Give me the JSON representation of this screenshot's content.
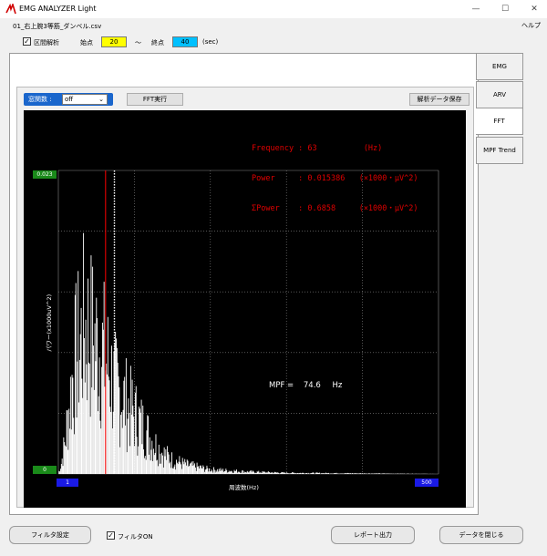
{
  "window": {
    "title": "EMG ANALYZER Light",
    "minimize_symbol": "—",
    "maximize_symbol": "☐",
    "close_symbol": "✕"
  },
  "file_name": "01_右上腕3等筋_ダンベル.csv",
  "help_label": "ヘルプ",
  "interval": {
    "checkbox_label": "区間解析",
    "checked": true,
    "start_label": "始点",
    "start_value": "20",
    "tilde": "〜",
    "end_label": "終点",
    "end_value": "40",
    "unit": "(sec)",
    "start_color": "#ffff00",
    "end_color": "#00c0ff"
  },
  "tabs": [
    {
      "label": "EMG",
      "active": false
    },
    {
      "label": "ARV",
      "active": false
    },
    {
      "label": "FFT",
      "active": true
    },
    {
      "label": "MPF Trend",
      "active": false
    }
  ],
  "toolbar": {
    "window_fn_label": "窓関数 :",
    "window_fn_value": "off",
    "fft_button": "FFT実行",
    "save_button": "解析データ保存"
  },
  "info_lines": [
    "Frequency : 63          (Hz)",
    "Power     : 0.015386   (×1000・μV^2)",
    "ΣPower    : 0.6858     (×1000・μV^2)"
  ],
  "mpf": {
    "label": "MPF =",
    "value": "74.6",
    "unit": "Hz"
  },
  "chart_data": {
    "type": "bar",
    "ylabel": "パワー(x1000uV^2)",
    "xlabel": "周波数(Hz)",
    "ymax_label": "0.023",
    "ymin_label": "0",
    "xmin_label": "1",
    "xmax_label": "500",
    "xlim": [
      1,
      500
    ],
    "ylim": [
      0,
      0.023
    ],
    "cursor_red_hz": 63,
    "cursor_dotted_hz": 74.6,
    "envelope": [
      [
        1,
        0.0
      ],
      [
        5,
        0.001
      ],
      [
        10,
        0.003
      ],
      [
        15,
        0.006
      ],
      [
        20,
        0.009
      ],
      [
        25,
        0.011
      ],
      [
        30,
        0.012
      ],
      [
        35,
        0.0135
      ],
      [
        40,
        0.013
      ],
      [
        45,
        0.0125
      ],
      [
        50,
        0.012
      ],
      [
        55,
        0.0115
      ],
      [
        60,
        0.011
      ],
      [
        65,
        0.01
      ],
      [
        70,
        0.009
      ],
      [
        75,
        0.008
      ],
      [
        80,
        0.0075
      ],
      [
        90,
        0.0065
      ],
      [
        100,
        0.0055
      ],
      [
        110,
        0.0045
      ],
      [
        120,
        0.0035
      ],
      [
        130,
        0.0025
      ],
      [
        140,
        0.0018
      ],
      [
        150,
        0.0013
      ],
      [
        170,
        0.0008
      ],
      [
        200,
        0.0004
      ],
      [
        250,
        0.0002
      ],
      [
        300,
        0.0001
      ],
      [
        400,
        5e-05
      ],
      [
        500,
        0.0
      ]
    ],
    "colors": {
      "bars": "#ffffff",
      "cursor": "#ff0000",
      "grid": "#888888"
    }
  },
  "bottom": {
    "filter_settings": "フィルタ設定",
    "filter_on_label": "フィルタON",
    "filter_on_checked": true,
    "report_button": "レポート出力",
    "close_data_button": "データを閉じる"
  }
}
